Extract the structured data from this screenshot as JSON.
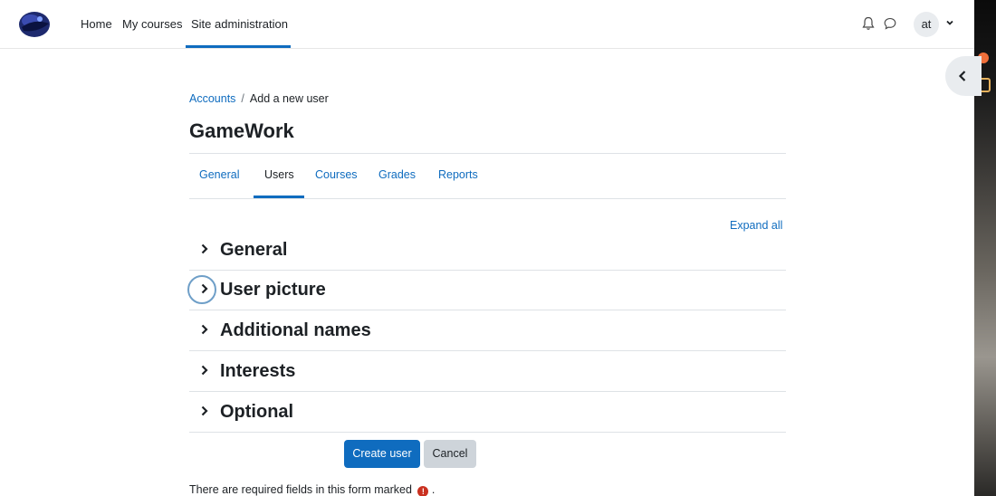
{
  "navbar": {
    "items": [
      {
        "label": "Home"
      },
      {
        "label": "My courses"
      },
      {
        "label": "Site administration"
      }
    ],
    "user_initials": "at"
  },
  "breadcrumb": {
    "link": "Accounts",
    "separator": "/",
    "current": "Add a new user"
  },
  "page_title": "GameWork",
  "tabs": [
    {
      "label": "General"
    },
    {
      "label": "Users"
    },
    {
      "label": "Courses"
    },
    {
      "label": "Grades"
    },
    {
      "label": "Reports"
    }
  ],
  "expand_all_label": "Expand all",
  "sections": [
    {
      "label": "General"
    },
    {
      "label": "User picture"
    },
    {
      "label": "Additional names"
    },
    {
      "label": "Interests"
    },
    {
      "label": "Optional"
    }
  ],
  "buttons": {
    "create": "Create user",
    "cancel": "Cancel"
  },
  "required_note": "There are required fields in this form marked",
  "required_note_end": ".",
  "required_icon_glyph": "!",
  "colors": {
    "link": "#0f6cbf",
    "primary_button": "#0f6cbf",
    "required_icon": "#ca3120"
  }
}
